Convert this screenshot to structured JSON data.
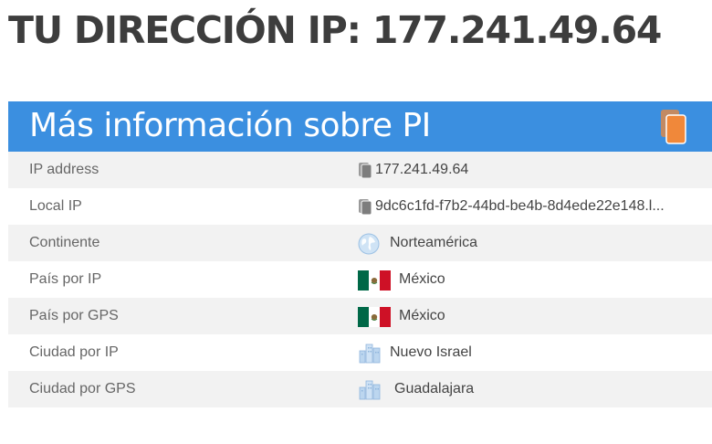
{
  "headline": "TU DIRECCIÓN IP: 177.241.49.64",
  "panel": {
    "title": "Más información sobre PI",
    "copy_icon": "copy-icon",
    "accent_color": "#3b8fe0",
    "copy_color": "#f0883a"
  },
  "rows": [
    {
      "label": "IP address",
      "value": "177.241.49.64",
      "icon": "copy-icon"
    },
    {
      "label": "Local IP",
      "value": "9dc6c1fd-f7b2-44bd-be4b-8d4ede22e148.l...",
      "icon": "copy-icon"
    },
    {
      "label": "Continente",
      "value": "Norteamérica",
      "icon": "globe-icon"
    },
    {
      "label": "País por IP",
      "value": "México",
      "icon": "mexico-flag-icon"
    },
    {
      "label": "País por GPS",
      "value": "México",
      "icon": "mexico-flag-icon"
    },
    {
      "label": "Ciudad por IP",
      "value": "Nuevo Israel",
      "icon": "city-icon"
    },
    {
      "label": "Ciudad por GPS",
      "value": "Guadalajara",
      "icon": "city-icon"
    }
  ]
}
